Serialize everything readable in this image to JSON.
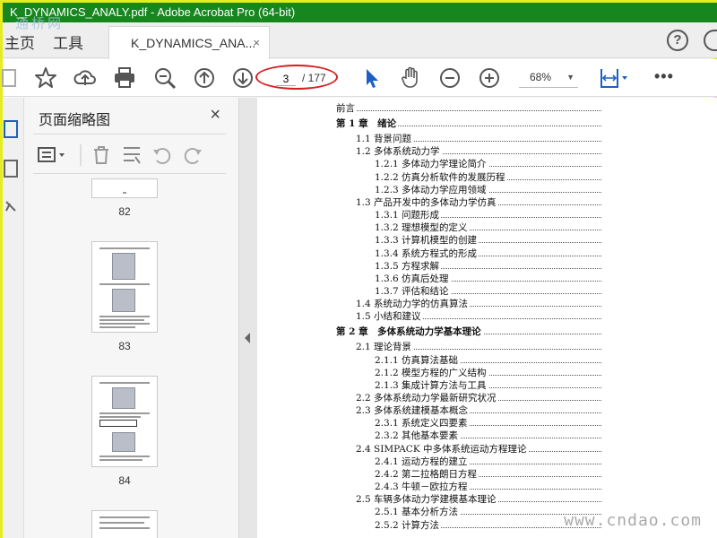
{
  "window": {
    "title": "K_DYNAMICS_ANALY.pdf - Adobe Acrobat Pro (64-bit)"
  },
  "nav": {
    "home": "主页",
    "tools": "工具"
  },
  "doc_tab": {
    "label": "K_DYNAMICS_ANA...",
    "close": "×"
  },
  "help": "?",
  "toolbar": {
    "page_current": "3",
    "page_total": "/ 177",
    "zoom": "68%"
  },
  "panel": {
    "title": "页面缩略图",
    "close": "×"
  },
  "thumbnails": [
    {
      "num": "82"
    },
    {
      "num": "83"
    },
    {
      "num": "84"
    }
  ],
  "toc": [
    {
      "text": "前言",
      "level": 0,
      "chapter": false
    },
    {
      "text": "第 1 章　绪论",
      "level": 0,
      "chapter": true
    },
    {
      "text": "1.1 背景问题",
      "level": 1,
      "chapter": false
    },
    {
      "text": "1.2 多体系统动力学",
      "level": 1,
      "chapter": false
    },
    {
      "text": "1.2.1 多体动力学理论简介",
      "level": 2,
      "chapter": false
    },
    {
      "text": "1.2.2 仿真分析软件的发展历程",
      "level": 2,
      "chapter": false
    },
    {
      "text": "1.2.3 多体动力学应用领域",
      "level": 2,
      "chapter": false
    },
    {
      "text": "1.3 产品开发中的多体动力学仿真",
      "level": 1,
      "chapter": false
    },
    {
      "text": "1.3.1 问题形成",
      "level": 2,
      "chapter": false
    },
    {
      "text": "1.3.2 理想模型的定义",
      "level": 2,
      "chapter": false
    },
    {
      "text": "1.3.3 计算机模型的创建",
      "level": 2,
      "chapter": false
    },
    {
      "text": "1.3.4 系统方程式的形成",
      "level": 2,
      "chapter": false
    },
    {
      "text": "1.3.5 方程求解",
      "level": 2,
      "chapter": false
    },
    {
      "text": "1.3.6 仿真后处理",
      "level": 2,
      "chapter": false
    },
    {
      "text": "1.3.7 评估和结论",
      "level": 2,
      "chapter": false
    },
    {
      "text": "1.4 系统动力学的仿真算法",
      "level": 1,
      "chapter": false
    },
    {
      "text": "1.5 小结和建议",
      "level": 1,
      "chapter": false
    },
    {
      "text": "第 2 章　多体系统动力学基本理论",
      "level": 0,
      "chapter": true
    },
    {
      "text": "2.1 理论背景",
      "level": 1,
      "chapter": false
    },
    {
      "text": "2.1.1 仿真算法基础",
      "level": 2,
      "chapter": false
    },
    {
      "text": "2.1.2 模型方程的广义结构",
      "level": 2,
      "chapter": false
    },
    {
      "text": "2.1.3 集成计算方法与工具",
      "level": 2,
      "chapter": false
    },
    {
      "text": "2.2 多体系统动力学最新研究状况",
      "level": 1,
      "chapter": false
    },
    {
      "text": "2.3 多体系统建模基本概念",
      "level": 1,
      "chapter": false
    },
    {
      "text": "2.3.1 系统定义四要素",
      "level": 2,
      "chapter": false
    },
    {
      "text": "2.3.2 其他基本要素",
      "level": 2,
      "chapter": false
    },
    {
      "text": "2.4 SIMPACK 中多体系统运动方程理论",
      "level": 1,
      "chapter": false
    },
    {
      "text": "2.4.1 运动方程的建立",
      "level": 2,
      "chapter": false
    },
    {
      "text": "2.4.2 第二拉格朗日方程",
      "level": 2,
      "chapter": false
    },
    {
      "text": "2.4.3 牛顿－欧拉方程",
      "level": 2,
      "chapter": false
    },
    {
      "text": "2.5 车辆多体动力学建模基本理论",
      "level": 1,
      "chapter": false
    },
    {
      "text": "2.5.1 基本分析方法",
      "level": 2,
      "chapter": false
    },
    {
      "text": "2.5.2 计算方法",
      "level": 2,
      "chapter": false
    }
  ],
  "watermarks": {
    "top": "通桥网",
    "bottom": "www.cndao.com"
  }
}
